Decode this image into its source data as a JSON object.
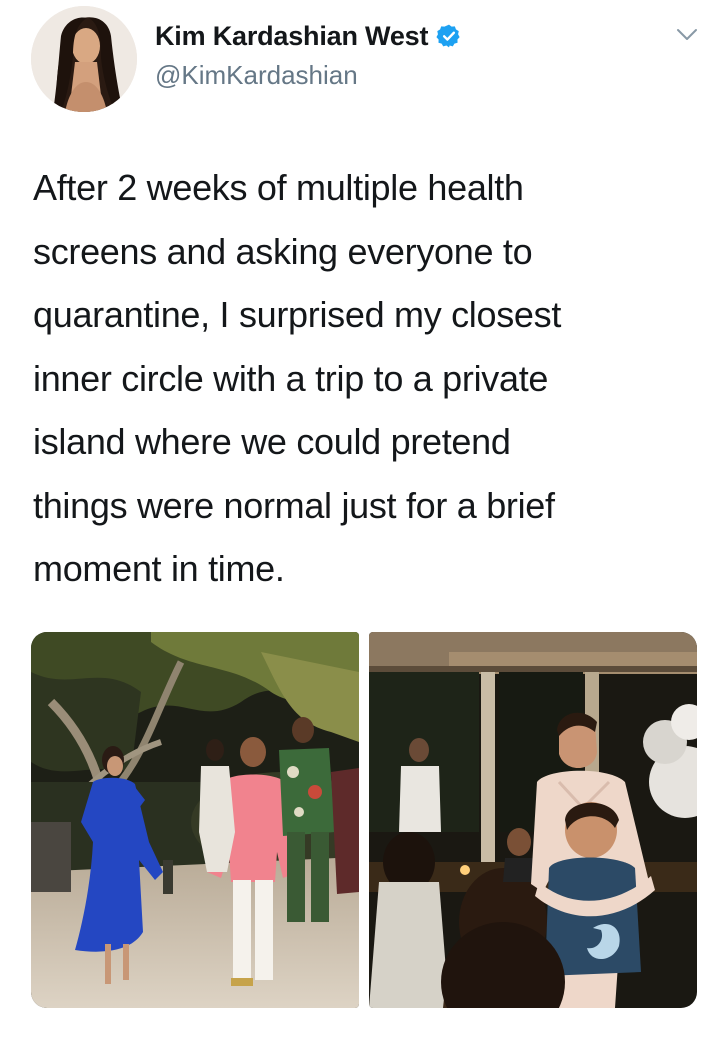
{
  "author": {
    "display_name": "Kim Kardashian West",
    "handle": "@KimKardashian",
    "verified": true
  },
  "tweet": {
    "text_lines": [
      "After 2 weeks of multiple health",
      "screens and asking everyone to",
      "quarantine, I surprised my closest",
      "inner circle with a trip to a private",
      "island where we could pretend",
      "things were normal just for a brief",
      "moment in time."
    ]
  },
  "media": {
    "photos": [
      {
        "name": "beach-night-group-photo"
      },
      {
        "name": "dinner-party-photo"
      }
    ]
  },
  "icons": {
    "verified": "verified-badge-icon",
    "menu": "chevron-down-icon"
  },
  "colors": {
    "text": "#14171a",
    "secondary": "#657786",
    "verified": "#1da1f2"
  }
}
